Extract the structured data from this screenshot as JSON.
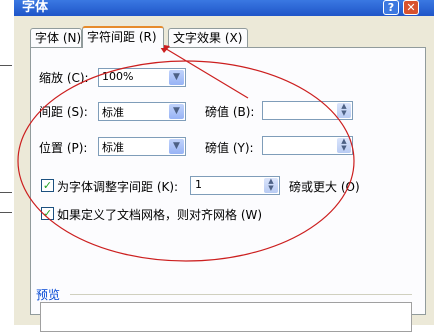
{
  "dialog": {
    "title": "字体",
    "help_label": "?",
    "close_label": "✕"
  },
  "tabs": [
    {
      "label": "字体 (N)"
    },
    {
      "label": "字符间距 (R)"
    },
    {
      "label": "文字效果 (X)"
    }
  ],
  "scale": {
    "label": "缩放 (C):",
    "value": "100%"
  },
  "spacing": {
    "label": "间距 (S):",
    "value": "标准",
    "by_label": "磅值 (B):",
    "by_value": ""
  },
  "position": {
    "label": "位置 (P):",
    "value": "标准",
    "by_label": "磅值 (Y):",
    "by_value": ""
  },
  "kerning": {
    "label": "为字体调整字间距 (K):",
    "value": "1",
    "suffix": "磅或更大 (O)",
    "checked": true
  },
  "grid": {
    "label": "如果定义了文档网格，则对齐网格 (W)",
    "checked": true
  },
  "preview": {
    "label": "预览"
  },
  "annotation_color": "#cc1f1f"
}
